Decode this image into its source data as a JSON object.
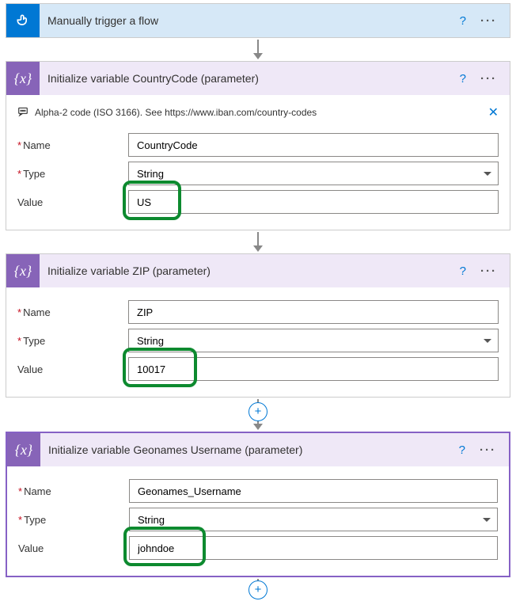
{
  "cards": {
    "trigger": {
      "title": "Manually trigger a flow"
    },
    "var1": {
      "title": "Initialize variable CountryCode (parameter)",
      "note": "Alpha-2 code (ISO 3166). See https://www.iban.com/country-codes",
      "name_label": "Name",
      "name_value": "CountryCode",
      "type_label": "Type",
      "type_value": "String",
      "value_label": "Value",
      "value_value": "US"
    },
    "var2": {
      "title": "Initialize variable ZIP (parameter)",
      "name_label": "Name",
      "name_value": "ZIP",
      "type_label": "Type",
      "type_value": "String",
      "value_label": "Value",
      "value_value": "10017"
    },
    "var3": {
      "title": "Initialize variable Geonames Username (parameter)",
      "name_label": "Name",
      "name_value": "Geonames_Username",
      "type_label": "Type",
      "type_value": "String",
      "value_label": "Value",
      "value_value": "johndoe"
    }
  },
  "labels": {
    "help": "?",
    "menu": "···",
    "close": "✕",
    "plus": "+"
  }
}
